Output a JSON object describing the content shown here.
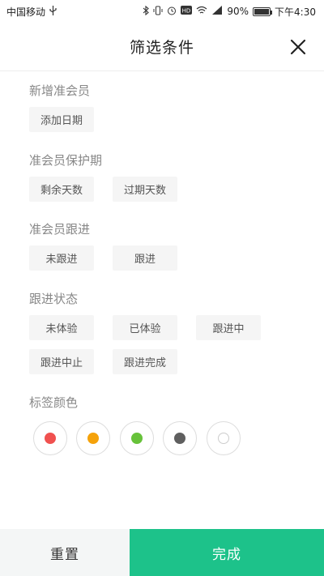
{
  "status_bar": {
    "carrier": "中国移动",
    "battery": "90%",
    "battery_level": 0.9,
    "time": "下午4:30",
    "icons": [
      "usb-icon",
      "bluetooth-icon",
      "vibrate-icon",
      "alarm-icon",
      "hd-icon",
      "wifi-icon",
      "signal-icon",
      "battery-icon"
    ]
  },
  "header": {
    "title": "筛选条件",
    "close_icon": "close-icon"
  },
  "sections": [
    {
      "title": "新增准会员",
      "chips": [
        "添加日期"
      ]
    },
    {
      "title": "准会员保护期",
      "chips": [
        "剩余天数",
        "过期天数"
      ]
    },
    {
      "title": "准会员跟进",
      "chips": [
        "未跟进",
        "跟进"
      ]
    },
    {
      "title": "跟进状态",
      "chips": [
        "未体验",
        "已体验",
        "跟进中",
        "跟进中止",
        "跟进完成"
      ]
    },
    {
      "title": "标签颜色"
    }
  ],
  "tag_colors": [
    "#f0514f",
    "#f5a20a",
    "#67c23a",
    "#5f5f5f",
    "#ffffff"
  ],
  "footer": {
    "reset_label": "重置",
    "done_label": "完成"
  }
}
